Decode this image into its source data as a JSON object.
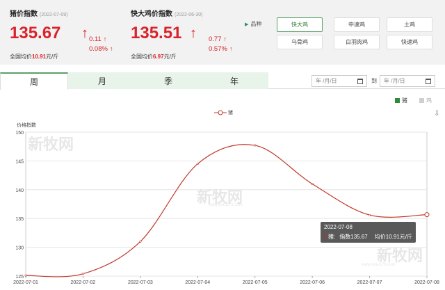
{
  "pig": {
    "title": "猪价指数",
    "date": "(2022-07-09)",
    "value": "135.67",
    "arrow": "↑",
    "change_abs": "0.11",
    "change_pct": "0.08%",
    "avg_prefix": "全国均价",
    "avg_value": "10.91",
    "avg_unit": "元/斤"
  },
  "chicken": {
    "title": "快大鸡价指数",
    "date": "(2022-06-30)",
    "value": "135.51",
    "arrow": "↑",
    "change_abs": "0.77",
    "change_pct": "0.57%",
    "avg_prefix": "全国均价",
    "avg_value": "6.97",
    "avg_unit": "元/斤"
  },
  "breed": {
    "label": "品种",
    "buttons": [
      "快大鸡",
      "中速鸡",
      "土鸡",
      "乌骨鸡",
      "白羽肉鸡",
      "快速鸡"
    ],
    "active": "快大鸡"
  },
  "tabs": [
    "周",
    "月",
    "季",
    "年"
  ],
  "date_range": {
    "start_placeholder": "年 /月/日",
    "to_label": "到",
    "end_placeholder": "年 /月/日"
  },
  "series_toggle": [
    {
      "label": "猪",
      "color": "#2e8b3a"
    },
    {
      "label": "鸡",
      "color": "#cfcfcf"
    }
  ],
  "download_icon": "download-icon",
  "watermarks": [
    "新牧网",
    "新牧网",
    "新牧网"
  ],
  "watermark_sub": "www.xmu178.com",
  "tooltip": {
    "date": "2022-07-08",
    "series": "猪:",
    "index_text": "指数135.67",
    "price_text": "均价10.91元/斤"
  },
  "colors": {
    "accent_red": "#d8232a",
    "line_red": "#c0392b",
    "green": "#5aa06a"
  },
  "chart_data": {
    "type": "line",
    "ylabel": "价格指数",
    "legend": [
      "猪"
    ],
    "categories": [
      "2022-07-01",
      "2022-07-02",
      "2022-07-03",
      "2022-07-04",
      "2022-07-05",
      "2022-07-06",
      "2022-07-07",
      "2022-07-08"
    ],
    "series": [
      {
        "name": "猪",
        "values": [
          125.1,
          125.4,
          131.0,
          144.5,
          147.7,
          141.0,
          135.6,
          135.67
        ]
      }
    ],
    "ylim": [
      125,
      150
    ],
    "yticks": [
      125,
      130,
      135,
      140,
      145,
      150
    ],
    "grid": true
  }
}
